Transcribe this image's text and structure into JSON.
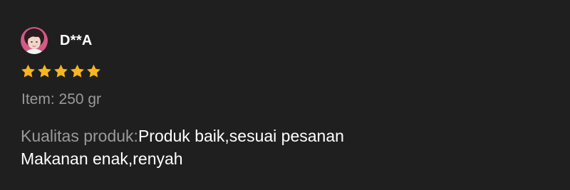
{
  "review": {
    "username": "D**A",
    "rating": 5,
    "rating_max": 5,
    "variant_text": "Item: 250 gr",
    "quality_label": "Kualitas produk:",
    "quality_value": "Produk baik,sesuai pesanan",
    "comment_line2": "Makanan enak,renyah"
  },
  "colors": {
    "background": "#1f1f1f",
    "star": "#f8b51e",
    "muted_text": "#9a9a9a",
    "primary_text": "#ffffff",
    "avatar_background": "#d45a86"
  },
  "icons": {
    "avatar": "user-avatar-photo",
    "star": "star-icon"
  }
}
